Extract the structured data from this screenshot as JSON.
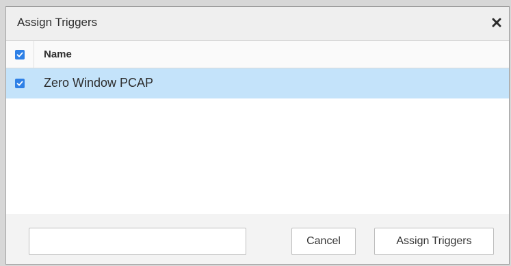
{
  "dialog": {
    "title": "Assign Triggers",
    "close_icon": "close-icon"
  },
  "table": {
    "select_all_checked": true,
    "columns": [
      "Name"
    ],
    "rows": [
      {
        "name": "Zero Window PCAP",
        "checked": true,
        "selected": true
      }
    ]
  },
  "footer": {
    "filter_value": "",
    "cancel_label": "Cancel",
    "assign_label": "Assign Triggers"
  },
  "colors": {
    "checkbox": "#2e80e6",
    "selected_row": "#c4e3fa",
    "titlebar_bg": "#efefef",
    "footer_bg": "#f3f3f3"
  }
}
